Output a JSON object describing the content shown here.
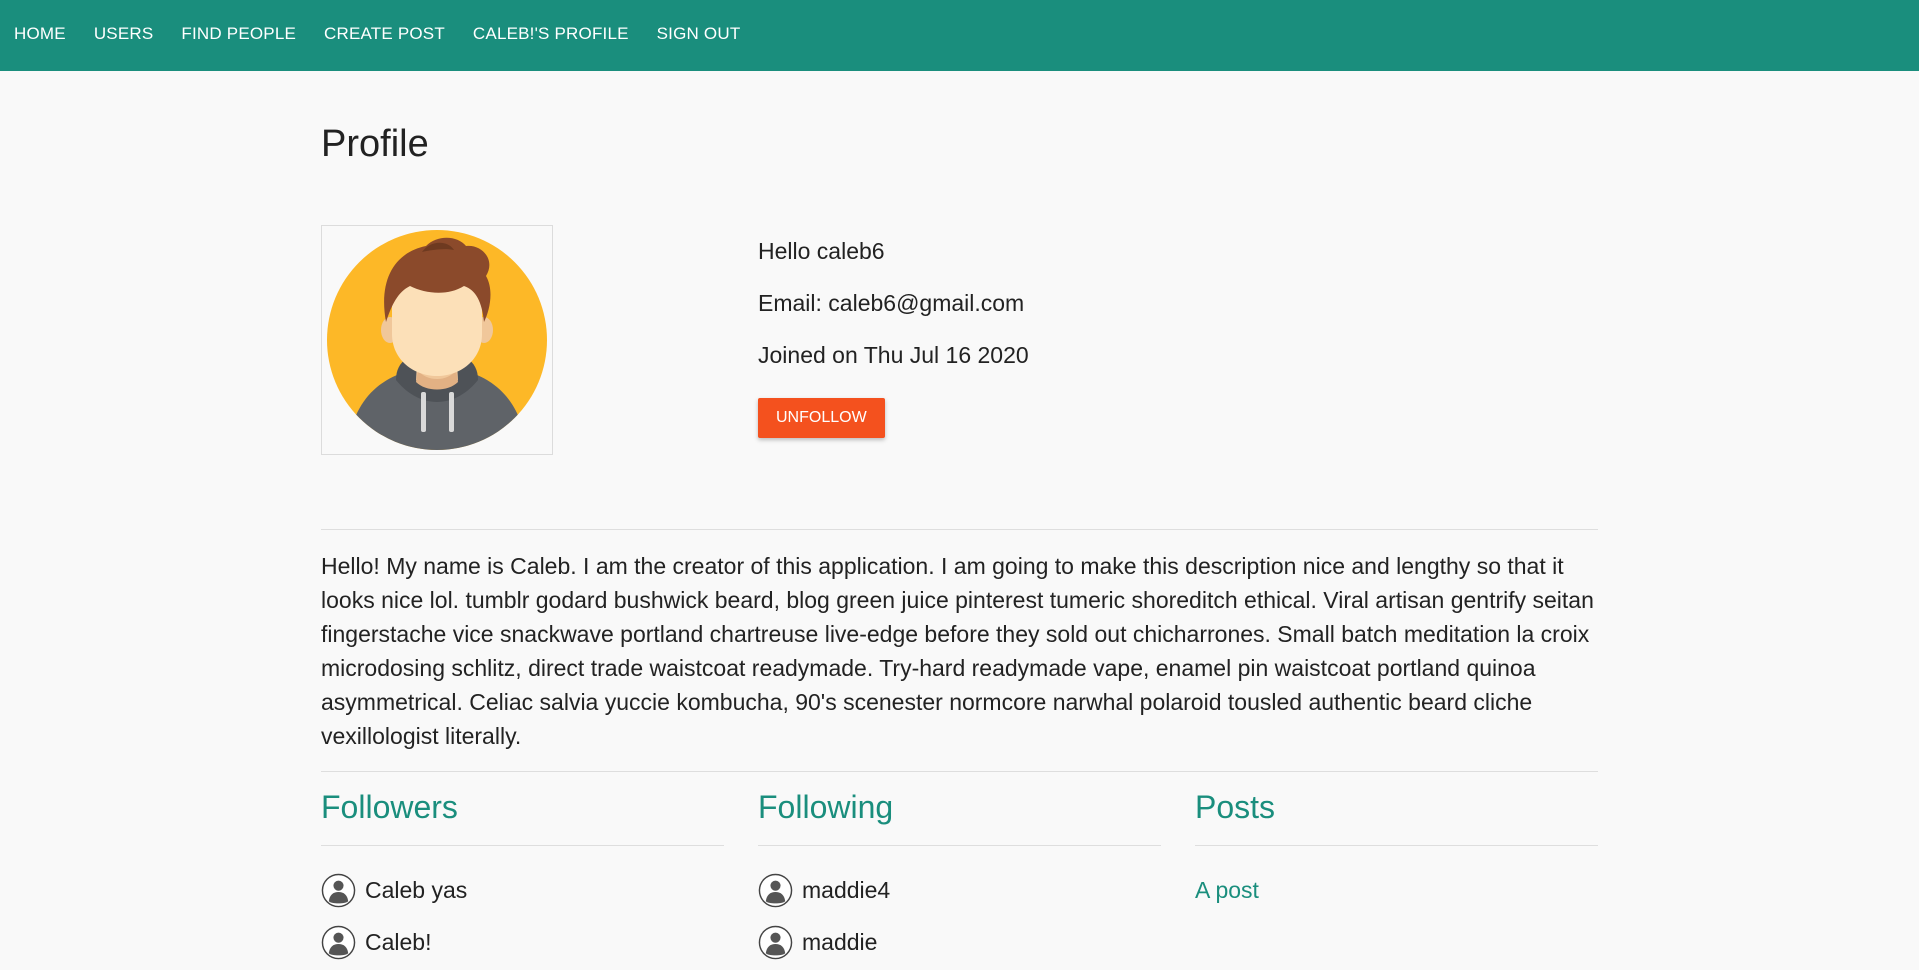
{
  "nav": {
    "items": [
      {
        "label": "HOME"
      },
      {
        "label": "USERS"
      },
      {
        "label": "FIND PEOPLE"
      },
      {
        "label": "CREATE POST"
      },
      {
        "label": "CALEB!'S PROFILE"
      },
      {
        "label": "SIGN OUT"
      }
    ]
  },
  "profile": {
    "title": "Profile",
    "greeting": "Hello caleb6",
    "email": "Email: caleb6@gmail.com",
    "joined": "Joined on Thu Jul 16 2020",
    "unfollow_label": "UNFOLLOW",
    "about": "Hello! My name is Caleb. I am the creator of this application. I am going to make this description nice and lengthy so that it looks nice lol. tumblr godard bushwick beard, blog green juice pinterest tumeric shoreditch ethical. Viral artisan gentrify seitan fingerstache vice snackwave portland chartreuse live-edge before they sold out chicharrones. Small batch meditation la croix microdosing schlitz, direct trade waistcoat readymade. Try-hard readymade vape, enamel pin waistcoat portland quinoa asymmetrical. Celiac salvia yuccie kombucha, 90's scenester normcore narwhal polaroid tousled authentic beard cliche vexillologist literally."
  },
  "followers": {
    "title": "Followers",
    "items": [
      {
        "name": "Caleb yas"
      },
      {
        "name": "Caleb!"
      }
    ]
  },
  "following": {
    "title": "Following",
    "items": [
      {
        "name": "maddie4"
      },
      {
        "name": "maddie"
      }
    ]
  },
  "posts": {
    "title": "Posts",
    "items": [
      {
        "title": "A post"
      }
    ]
  },
  "colors": {
    "brand": "#1a8e7d",
    "danger": "#f4511e",
    "background": "#f9f9f9"
  }
}
